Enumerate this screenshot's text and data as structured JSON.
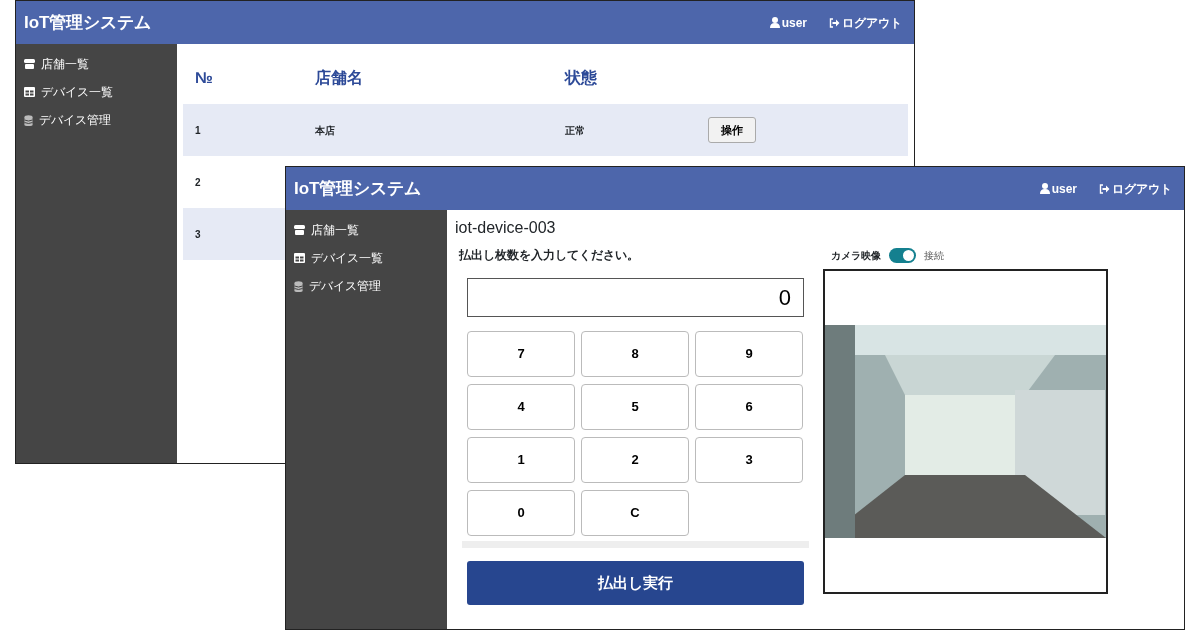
{
  "back_window": {
    "app_title": "IoT管理システム",
    "user": "user",
    "logout": "ログアウト",
    "sidebar": {
      "items": [
        {
          "kind": "store",
          "label": "店舗一覧"
        },
        {
          "kind": "grid",
          "label": "デバイス一覧"
        },
        {
          "kind": "database",
          "label": "デバイス管理"
        }
      ]
    },
    "table": {
      "columns": [
        "№",
        "店舗名",
        "状態"
      ],
      "rows": [
        {
          "no": "1",
          "name": "本店",
          "status": "正常",
          "action": "操作"
        },
        {
          "no": "2"
        },
        {
          "no": "3"
        }
      ]
    }
  },
  "front_window": {
    "app_title": "IoT管理システム",
    "user": "user",
    "logout": "ログアウト",
    "sidebar": {
      "items": [
        {
          "kind": "store",
          "label": "店舗一覧"
        },
        {
          "kind": "grid",
          "label": "デバイス一覧"
        },
        {
          "kind": "database",
          "label": "デバイス管理"
        }
      ]
    },
    "device_title": "iot-device-003",
    "prompt": "払出し枚数を入力してください。",
    "display_value": "0",
    "keypad": [
      "7",
      "8",
      "9",
      "4",
      "5",
      "6",
      "1",
      "2",
      "3",
      "0",
      "C"
    ],
    "execute_button": "払出し実行",
    "camera": {
      "label": "カメラ映像",
      "connected": true,
      "toggle_label": "接続"
    }
  }
}
